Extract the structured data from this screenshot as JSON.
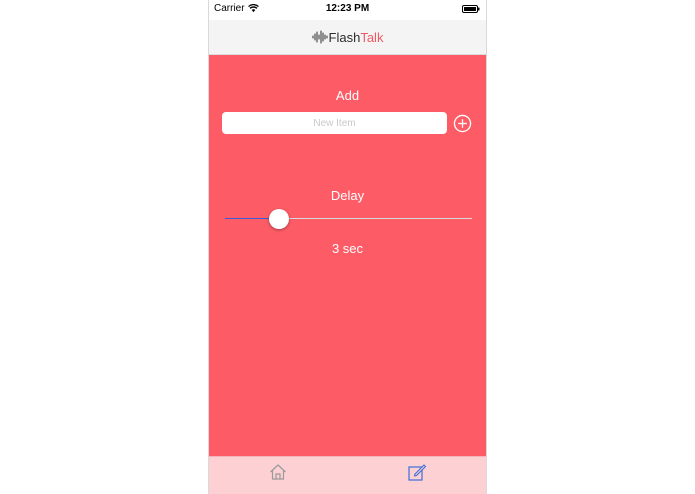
{
  "status_bar": {
    "carrier": "Carrier",
    "time": "12:23 PM",
    "wifi_icon": "wifi-icon",
    "battery_icon": "battery-icon"
  },
  "nav": {
    "logo_part1": "Flash",
    "logo_part2": "Talk",
    "logo_icon": "sound-wave-icon"
  },
  "add_section": {
    "title": "Add",
    "input_value": "",
    "input_placeholder": "New Item",
    "add_icon": "plus-circle-icon"
  },
  "delay_section": {
    "title": "Delay",
    "value_label": "3 sec",
    "slider_fraction": 0.19
  },
  "tabs": [
    {
      "icon": "home-icon",
      "selected": false
    },
    {
      "icon": "edit-icon",
      "selected": true
    }
  ],
  "colors": {
    "background": "#fd5c66",
    "tab_bar": "#fdd1d4",
    "slider_fill": "#3b5bd9",
    "tab_selected": "#3b6fd9",
    "tab_unselected": "#9a9a9a",
    "logo_accent": "#f15a64"
  }
}
